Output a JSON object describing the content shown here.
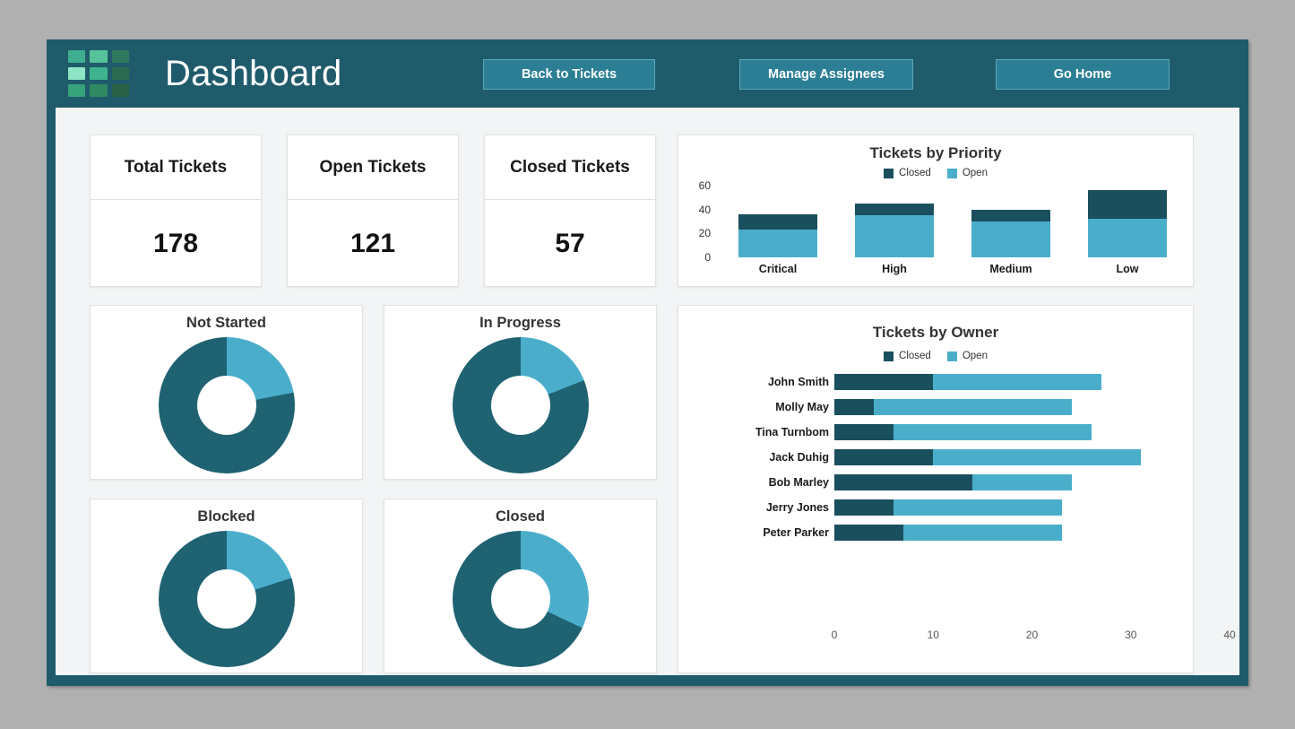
{
  "header": {
    "logo_name": "grid-logo",
    "title": "Dashboard",
    "buttons": [
      {
        "label": "Back to Tickets"
      },
      {
        "label": "Manage Assignees"
      },
      {
        "label": "Go Home"
      }
    ]
  },
  "kpis": [
    {
      "label": "Total Tickets",
      "value": "178"
    },
    {
      "label": "Open Tickets",
      "value": "121"
    },
    {
      "label": "Closed Tickets",
      "value": "57"
    }
  ],
  "donuts": [
    {
      "title": "Not Started",
      "percent": 22
    },
    {
      "title": "In Progress",
      "percent": 19
    },
    {
      "title": "Blocked",
      "percent": 20
    },
    {
      "title": "Closed",
      "percent": 32
    }
  ],
  "colors": {
    "closed": "#1a4f5e",
    "open": "#4aaecb",
    "header": "#1f5b6b",
    "button": "#2c7e95",
    "page_bg": "#b0b0b0",
    "content_bg": "#f2f4f5"
  },
  "legend": {
    "closed": "Closed",
    "open": "Open"
  },
  "chart_data": [
    {
      "type": "bar",
      "id": "tickets-by-priority",
      "title": "Tickets by Priority",
      "orientation": "vertical",
      "stacked": true,
      "categories": [
        "Critical",
        "High",
        "Medium",
        "Low"
      ],
      "series": [
        {
          "name": "Open",
          "values": [
            23,
            35,
            30,
            32
          ]
        },
        {
          "name": "Closed",
          "values": [
            13,
            10,
            10,
            24
          ]
        }
      ],
      "totals": [
        36,
        45,
        40,
        56
      ],
      "ylabel": "",
      "xlabel": "",
      "ylim": [
        0,
        60
      ],
      "yticks": [
        0,
        20,
        40,
        60
      ],
      "grid": false,
      "legend": [
        "Closed",
        "Open"
      ],
      "legend_position": "top"
    },
    {
      "type": "bar",
      "id": "tickets-by-owner",
      "title": "Tickets by Owner",
      "orientation": "horizontal",
      "stacked": true,
      "categories": [
        "John Smith",
        "Molly May",
        "Tina Turnbom",
        "Jack Duhig",
        "Bob Marley",
        "Jerry Jones",
        "Peter Parker"
      ],
      "series": [
        {
          "name": "Closed",
          "values": [
            10,
            4,
            6,
            10,
            14,
            6,
            7
          ]
        },
        {
          "name": "Open",
          "values": [
            17,
            20,
            20,
            21,
            10,
            17,
            16
          ]
        }
      ],
      "totals": [
        27,
        24,
        26,
        31,
        24,
        23,
        23
      ],
      "xlabel": "",
      "ylabel": "",
      "xlim": [
        0,
        40
      ],
      "xticks": [
        0,
        10,
        20,
        30,
        40
      ],
      "grid": false,
      "legend": [
        "Closed",
        "Open"
      ],
      "legend_position": "top"
    }
  ]
}
